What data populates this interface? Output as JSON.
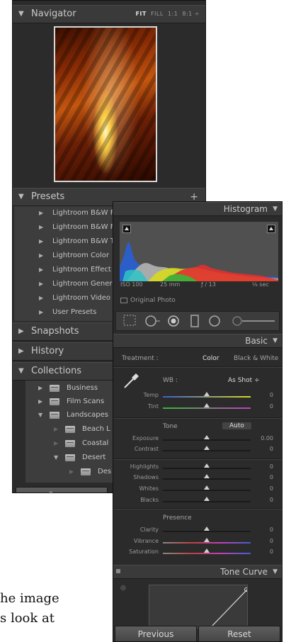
{
  "navigator": {
    "title": "Navigator",
    "zoom_options": [
      "FIT",
      "FILL",
      "1:1",
      "8:1"
    ]
  },
  "presets": {
    "title": "Presets",
    "items": [
      "Lightroom B&W F",
      "Lightroom B&W F",
      "Lightroom B&W T",
      "Lightroom Color",
      "Lightroom Effect",
      "Lightroom Gener",
      "Lightroom Video",
      "User Presets"
    ]
  },
  "snapshots": {
    "title": "Snapshots"
  },
  "history": {
    "title": "History"
  },
  "collections": {
    "title": "Collections",
    "items": [
      {
        "label": "Business"
      },
      {
        "label": "Film Scans"
      },
      {
        "label": "Landscapes"
      },
      {
        "label": "Beach L"
      },
      {
        "label": "Coastal"
      },
      {
        "label": "Desert"
      },
      {
        "label": "Des"
      }
    ]
  },
  "left_buttons": {
    "copy": "Copy..."
  },
  "histogram": {
    "title": "Histogram",
    "iso": "ISO 100",
    "focal": "25 mm",
    "aperture": "ƒ / 13",
    "shutter": "⅛ sec",
    "original_photo": "Original Photo"
  },
  "basic": {
    "title": "Basic",
    "treatment_label": "Treatment :",
    "color": "Color",
    "bw": "Black & White",
    "wb_label": "WB :",
    "wb_value": "As Shot ÷",
    "temp_label": "Temp",
    "temp_value": "0",
    "tint_label": "Tint",
    "tint_value": "0",
    "tone_label": "Tone",
    "auto": "Auto",
    "exposure_label": "Exposure",
    "exposure_value": "0.00",
    "contrast_label": "Contrast",
    "contrast_value": "0",
    "highlights_label": "Highlights",
    "highlights_value": "0",
    "shadows_label": "Shadows",
    "shadows_value": "0",
    "whites_label": "Whites",
    "whites_value": "0",
    "blacks_label": "Blacks",
    "blacks_value": "0",
    "presence_label": "Presence",
    "clarity_label": "Clarity",
    "clarity_value": "0",
    "vibrance_label": "Vibrance",
    "vibrance_value": "0",
    "saturation_label": "Saturation",
    "saturation_value": "0"
  },
  "tone_curve": {
    "title": "Tone Curve"
  },
  "right_buttons": {
    "previous": "Previous",
    "reset": "Reset"
  },
  "background_text": {
    "line1": "he image",
    "line2": "s look at"
  },
  "colors": {
    "panel_bg": "#2b2b2b",
    "header_bg": "#3a3a3a",
    "text": "#c9c9c9"
  }
}
